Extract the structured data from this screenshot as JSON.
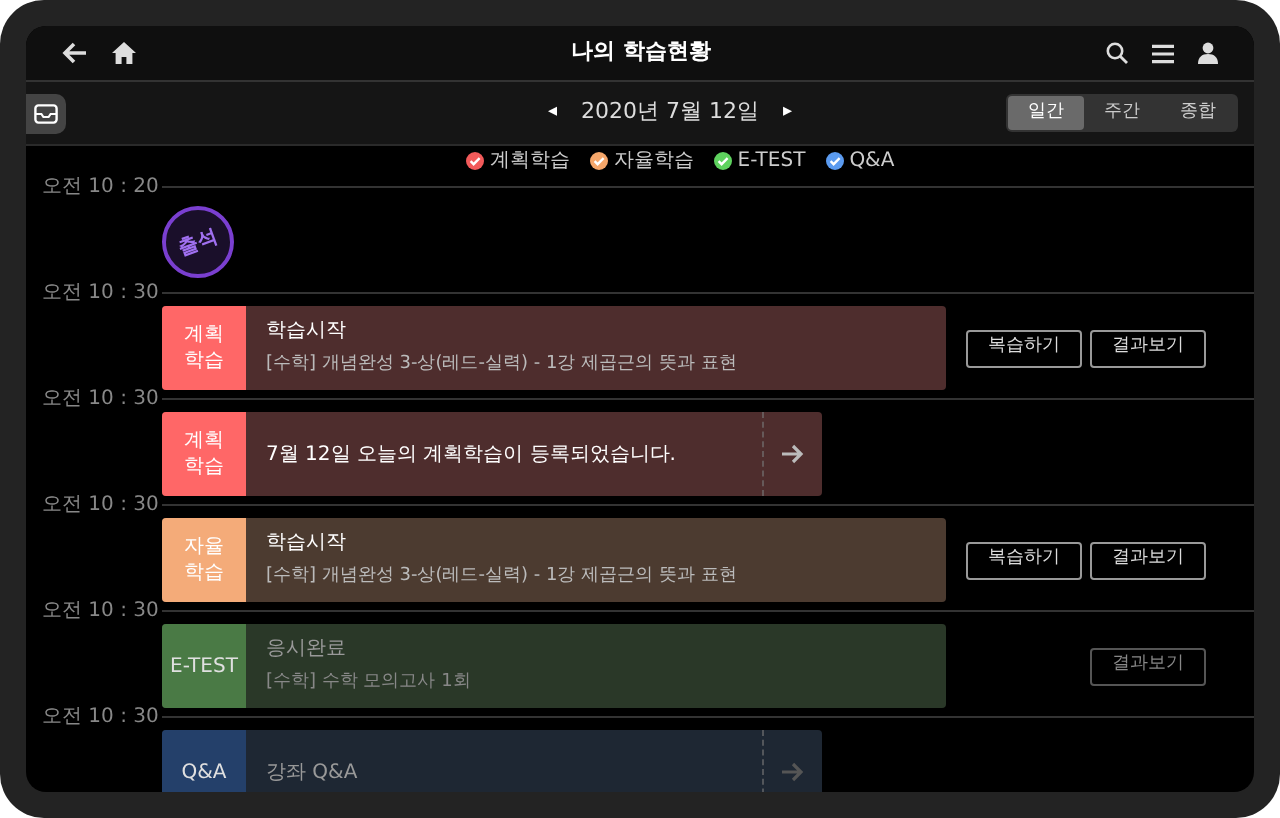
{
  "header": {
    "title": "나의 학습현황"
  },
  "date_nav": {
    "prev": "◂",
    "date": "2020년 7월 12일",
    "next": "▸"
  },
  "view_tabs": [
    {
      "label": "일간",
      "selected": true
    },
    {
      "label": "주간",
      "selected": false
    },
    {
      "label": "종합",
      "selected": false
    }
  ],
  "legend": [
    {
      "label": "계획학습",
      "color": "#f25a5a"
    },
    {
      "label": "자율학습",
      "color": "#f5a66a"
    },
    {
      "label": "E-TEST",
      "color": "#5ed25e"
    },
    {
      "label": "Q&A",
      "color": "#5b9bf0"
    }
  ],
  "timeline": [
    {
      "time": "오전 10 : 20",
      "kind": "stamp",
      "stamp": "출석"
    },
    {
      "time": "오전 10 : 30",
      "kind": "card",
      "color": "#ff6767",
      "dimmed": false,
      "badge": "계획 학습",
      "title": "학습시작",
      "subtitle": "[수학] 개념완성 3-상(레드-실력) - 1강 제곱근의 뜻과 표현",
      "buttons": [
        {
          "label": "복습하기"
        },
        {
          "label": "결과보기"
        }
      ]
    },
    {
      "time": "오전 10 : 30",
      "kind": "notice",
      "color": "#ff6767",
      "dimmed": false,
      "badge": "계획 학습",
      "title": "7월 12일 오늘의 계획학습이 등록되었습니다."
    },
    {
      "time": "오전 10 : 30",
      "kind": "card",
      "color": "#f4ab79",
      "dimmed": false,
      "badge": "자율 학습",
      "title": "학습시작",
      "subtitle": "[수학] 개념완성 3-상(레드-실력) - 1강 제곱근의 뜻과 표현",
      "buttons": [
        {
          "label": "복습하기"
        },
        {
          "label": "결과보기"
        }
      ]
    },
    {
      "time": "오전 10 : 30",
      "kind": "card",
      "color": "#4a7a45",
      "dimmed": true,
      "badge": "E-TEST",
      "title": "응시완료",
      "subtitle": "[수학] 수학 모의고사 1회",
      "buttons": [
        {
          "label": "결과보기"
        }
      ]
    },
    {
      "time": "오전 10 : 30",
      "kind": "notice",
      "color": "#24406a",
      "dimmed": true,
      "badge": "Q&A",
      "title": "강좌 Q&A"
    }
  ]
}
